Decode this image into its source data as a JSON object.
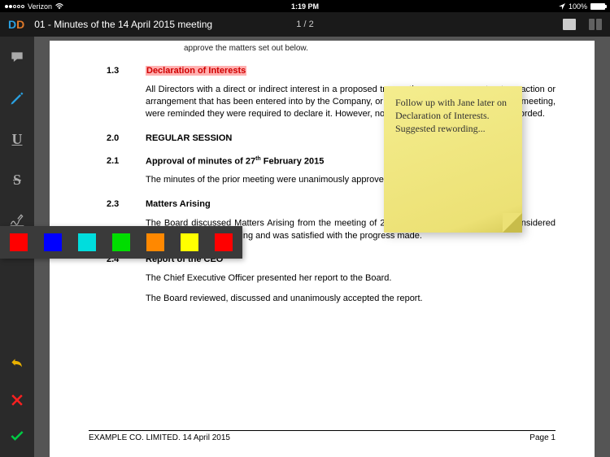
{
  "status_bar": {
    "carrier": "Verizon",
    "time": "1:19 PM",
    "battery": "100%"
  },
  "header": {
    "logo_1": "D",
    "logo_2": "D",
    "title": "01 - Minutes of the 14 April 2015 meeting",
    "pages": "1 / 2"
  },
  "colors": {
    "logo1": "#2aa0e0",
    "logo2": "#e07a2a",
    "palette": [
      "#ff0000",
      "#0000ff",
      "#00dddd",
      "#00dd00",
      "#ff8800",
      "#ffff00",
      "#ff0000"
    ]
  },
  "doc": {
    "truncated": "approve the matters set out below.",
    "s13_num": "1.3",
    "s13_title": "Declaration of Interests",
    "s13_body": "All Directors with a direct or indirect interest in a proposed transaction or arrangement, a transaction or arrangement that has been entered into by the Company, or in anything to be discussed at the meeting, were reminded they were required to declare it. However, no such conflicts of interest were recorded.",
    "s20_num": "2.0",
    "s20_title": "REGULAR SESSION",
    "s21_num": "2.1",
    "s21_title_a": "Approval of minutes of 27",
    "s21_title_sup": "th",
    "s21_title_b": " February 2015",
    "s21_body": "The minutes of the prior meeting were unanimously approved.",
    "s23_num": "2.3",
    "s23_title": "Matters Arising",
    "s23_body_a": "The Board discussed Matters Arising from the meeting of 27",
    "s23_body_sup": "th",
    "s23_body_b": " February 2015 and noted it considered none of them to be missing and was satisfied with the progress made.",
    "s24_num": "2.4",
    "s24_title": "Report of the CEO",
    "s24_body1": "The Chief Executive Officer presented her report to the Board.",
    "s24_body2": "The Board reviewed, discussed and unanimously accepted the report.",
    "footer_left": "EXAMPLE CO. LIMITED. 14 April 2015",
    "footer_right": "Page 1"
  },
  "sticky": {
    "text": "Follow up with Jane later on Declaration of Interests.  Suggested rewording..."
  }
}
